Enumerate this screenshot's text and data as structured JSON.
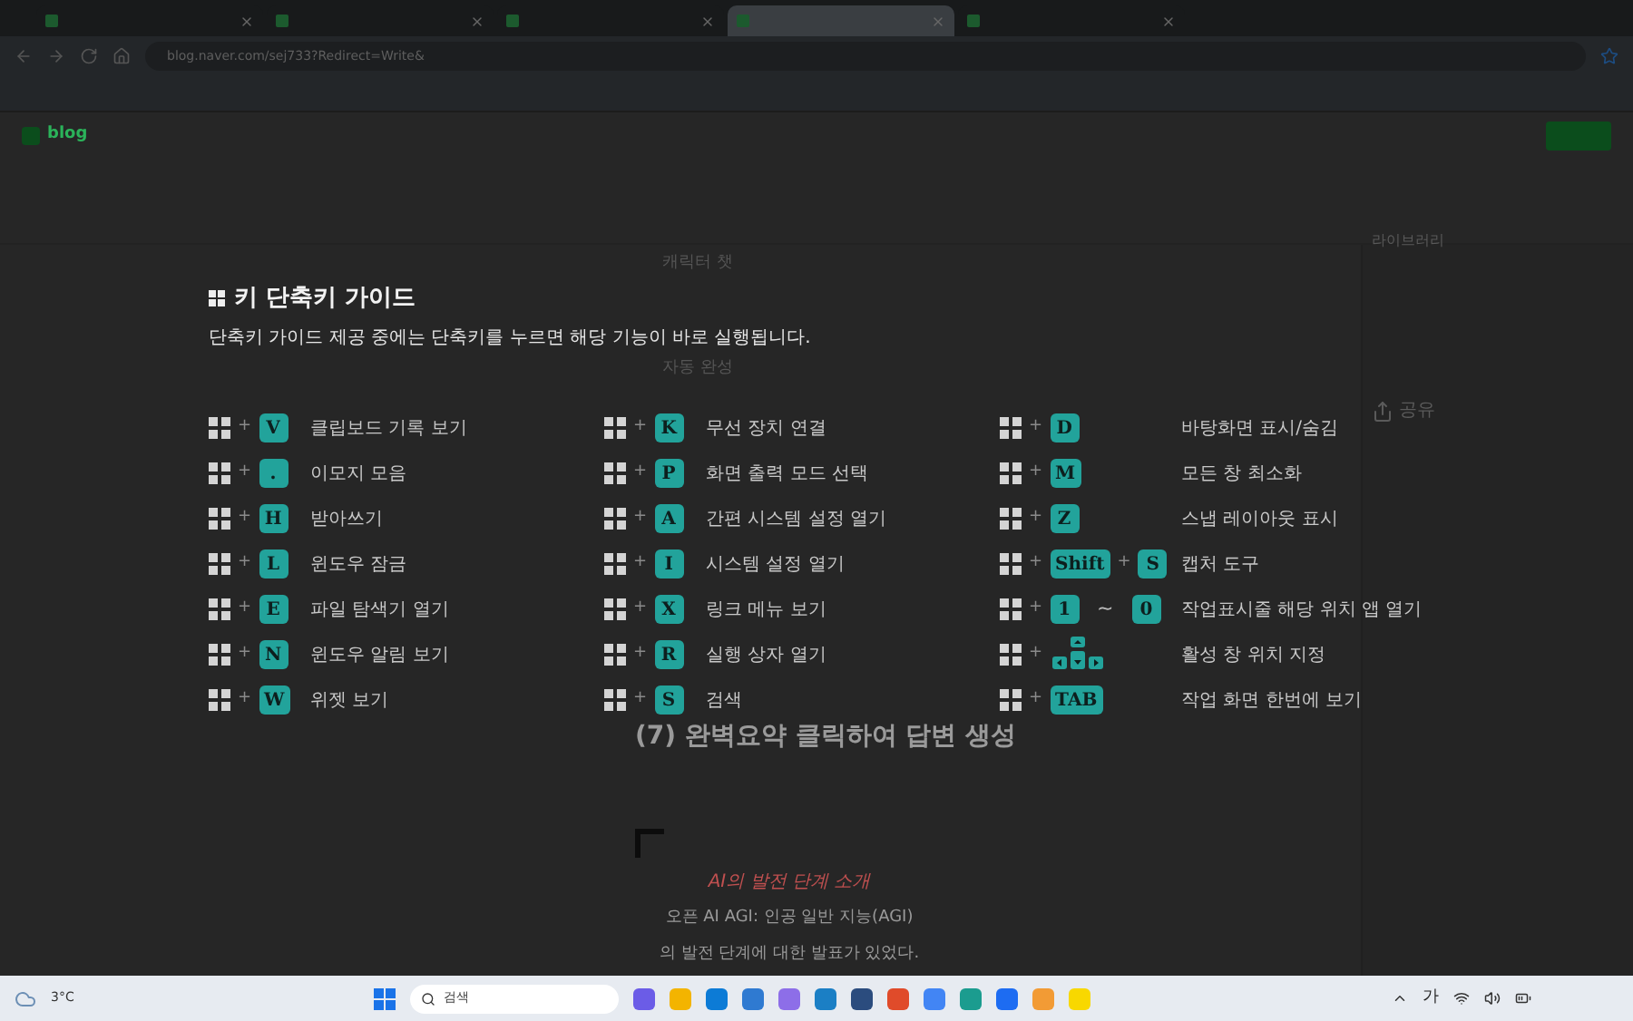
{
  "browser": {
    "tabs": [
      {
        "selected": false
      },
      {
        "selected": false
      },
      {
        "selected": false
      },
      {
        "selected": true
      },
      {
        "selected": false
      }
    ],
    "url": "blog.naver.com/sej733?Redirect=Write&"
  },
  "blog": {
    "logo": "blog"
  },
  "editor": {
    "menu_items": [
      "캐릭터 챗",
      "자동 완성"
    ],
    "heading": "(7) 완벽요약 클릭하여 답변 생성",
    "quote_title": "AI의 발전 단계 소개",
    "quote_lines": [
      "오픈 AI AGI: 인공 일반 지능(AGI)",
      "의 발전 단계에 대한 발표가 있었다."
    ]
  },
  "library": {
    "title": "라이브러리",
    "share": "공유"
  },
  "guide": {
    "title": "키 단축키 가이드",
    "subtitle": "단축키 가이드 제공 중에는 단축키를 누르면 해당 기능이 바로 실행됩니다.",
    "columns": [
      [
        {
          "parts": [
            {
              "kind": "plus",
              "text": "+"
            },
            {
              "kind": "key",
              "text": "V"
            }
          ],
          "label": "클립보드 기록 보기"
        },
        {
          "parts": [
            {
              "kind": "plus",
              "text": "+"
            },
            {
              "kind": "key",
              "text": "."
            }
          ],
          "label": "이모지 모음"
        },
        {
          "parts": [
            {
              "kind": "plus",
              "text": "+"
            },
            {
              "kind": "key",
              "text": "H"
            }
          ],
          "label": "받아쓰기"
        },
        {
          "parts": [
            {
              "kind": "plus",
              "text": "+"
            },
            {
              "kind": "key",
              "text": "L"
            }
          ],
          "label": "윈도우 잠금"
        },
        {
          "parts": [
            {
              "kind": "plus",
              "text": "+"
            },
            {
              "kind": "key",
              "text": "E"
            }
          ],
          "label": "파일 탐색기 열기"
        },
        {
          "parts": [
            {
              "kind": "plus",
              "text": "+"
            },
            {
              "kind": "key",
              "text": "N"
            }
          ],
          "label": "윈도우 알림 보기"
        },
        {
          "parts": [
            {
              "kind": "plus",
              "text": "+"
            },
            {
              "kind": "key",
              "text": "W"
            }
          ],
          "label": "위젯 보기"
        }
      ],
      [
        {
          "parts": [
            {
              "kind": "plus",
              "text": "+"
            },
            {
              "kind": "key",
              "text": "K"
            }
          ],
          "label": "무선 장치 연결"
        },
        {
          "parts": [
            {
              "kind": "plus",
              "text": "+"
            },
            {
              "kind": "key",
              "text": "P"
            }
          ],
          "label": "화면 출력 모드 선택"
        },
        {
          "parts": [
            {
              "kind": "plus",
              "text": "+"
            },
            {
              "kind": "key",
              "text": "A"
            }
          ],
          "label": "간편 시스템 설정 열기"
        },
        {
          "parts": [
            {
              "kind": "plus",
              "text": "+"
            },
            {
              "kind": "key",
              "text": "I"
            }
          ],
          "label": "시스템 설정 열기"
        },
        {
          "parts": [
            {
              "kind": "plus",
              "text": "+"
            },
            {
              "kind": "key",
              "text": "X"
            }
          ],
          "label": "링크 메뉴 보기"
        },
        {
          "parts": [
            {
              "kind": "plus",
              "text": "+"
            },
            {
              "kind": "key",
              "text": "R"
            }
          ],
          "label": "실행 상자 열기"
        },
        {
          "parts": [
            {
              "kind": "plus",
              "text": "+"
            },
            {
              "kind": "key",
              "text": "S"
            }
          ],
          "label": "검색"
        }
      ],
      [
        {
          "parts": [
            {
              "kind": "plus",
              "text": "+"
            },
            {
              "kind": "key",
              "text": "D"
            }
          ],
          "label": "바탕화면 표시/숨김"
        },
        {
          "parts": [
            {
              "kind": "plus",
              "text": "+"
            },
            {
              "kind": "key",
              "text": "M"
            }
          ],
          "label": "모든 창 최소화"
        },
        {
          "parts": [
            {
              "kind": "plus",
              "text": "+"
            },
            {
              "kind": "key",
              "text": "Z"
            }
          ],
          "label": "스냅 레이아웃 표시"
        },
        {
          "parts": [
            {
              "kind": "plus",
              "text": "+"
            },
            {
              "kind": "key",
              "text": "Shift"
            },
            {
              "kind": "plus",
              "text": "+"
            },
            {
              "kind": "key",
              "text": "S"
            }
          ],
          "label": "캡처 도구"
        },
        {
          "parts": [
            {
              "kind": "plus",
              "text": "+"
            },
            {
              "kind": "key",
              "text": "1"
            },
            {
              "kind": "range",
              "text": "~"
            },
            {
              "kind": "key",
              "text": "0"
            }
          ],
          "label": "작업표시줄 해당 위치 앱 열기"
        },
        {
          "parts": [
            {
              "kind": "plus",
              "text": "+"
            },
            {
              "kind": "arrows"
            }
          ],
          "label": "활성 창 위치 지정"
        },
        {
          "parts": [
            {
              "kind": "plus",
              "text": "+"
            },
            {
              "kind": "key",
              "text": "TAB"
            }
          ],
          "label": "작업 화면 한번에 보기"
        }
      ]
    ]
  },
  "taskbar": {
    "temperature": "3°C",
    "search_placeholder": "검색",
    "ime": "가"
  }
}
